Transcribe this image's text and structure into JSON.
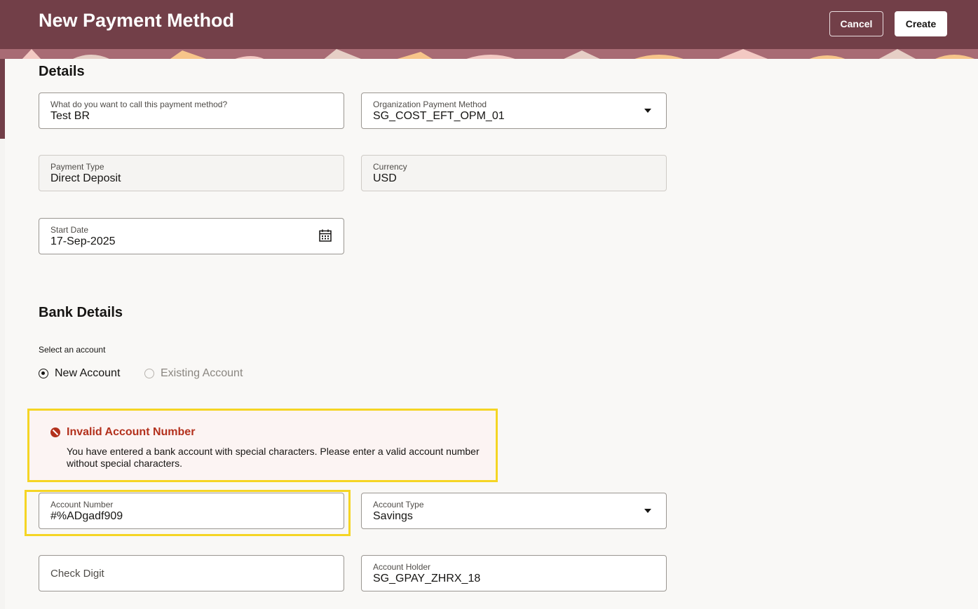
{
  "header": {
    "title": "New Payment Method",
    "cancel_label": "Cancel",
    "create_label": "Create",
    "brand_color": "#723f48"
  },
  "details": {
    "title": "Details",
    "name_field": {
      "label": "What do you want to call this payment method?",
      "value": "Test BR"
    },
    "org_payment_method": {
      "label": "Organization Payment Method",
      "value": "SG_COST_EFT_OPM_01"
    },
    "payment_type": {
      "label": "Payment Type",
      "value": "Direct Deposit"
    },
    "currency": {
      "label": "Currency",
      "value": "USD"
    },
    "start_date": {
      "label": "Start Date",
      "value": "17-Sep-2025",
      "icon": "calendar-icon"
    }
  },
  "bank_details": {
    "title": "Bank Details",
    "select_label": "Select an account",
    "options": [
      {
        "label": "New Account",
        "selected": true
      },
      {
        "label": "Existing Account",
        "selected": false
      }
    ],
    "error": {
      "icon": "error-circle-icon",
      "title": "Invalid Account Number",
      "message": "You have entered a bank account with special characters. Please enter a valid account number without special characters.",
      "color": "#b3311d"
    },
    "account_number": {
      "label": "Account Number",
      "value": "#%ADgadf909"
    },
    "account_type": {
      "label": "Account Type",
      "value": "Savings"
    },
    "check_digit": {
      "placeholder": "Check Digit"
    },
    "account_holder": {
      "label": "Account Holder",
      "value": "SG_GPAY_ZHRX_18"
    }
  },
  "highlight_color": "#f5d524"
}
